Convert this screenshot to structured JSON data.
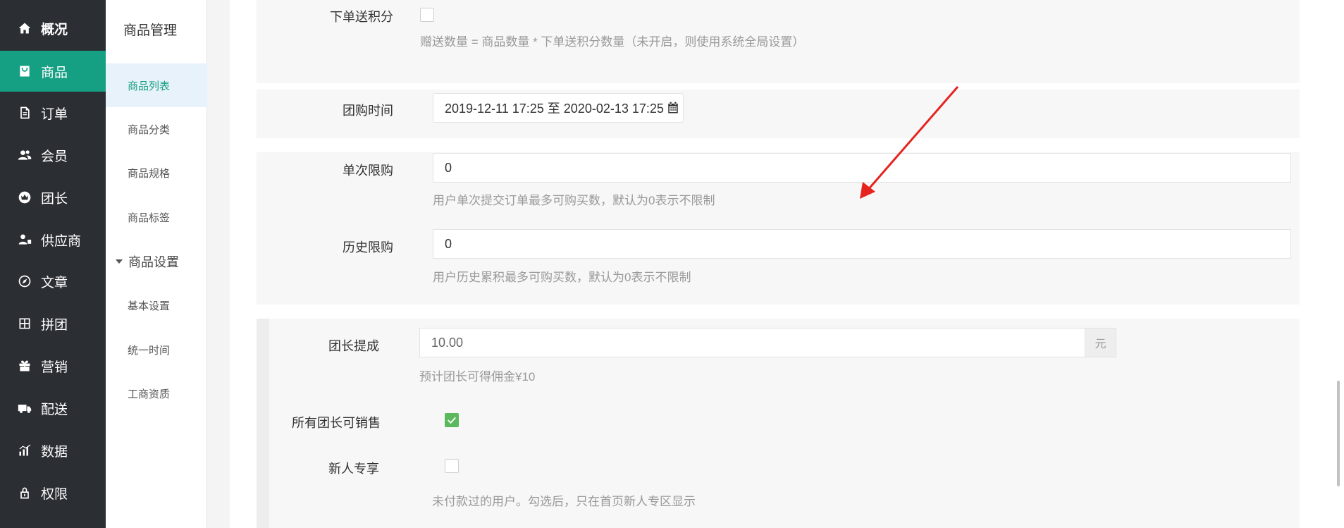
{
  "nav": {
    "items": [
      {
        "label": "概况",
        "icon": "home-icon"
      },
      {
        "label": "商品",
        "icon": "bag-icon"
      },
      {
        "label": "订单",
        "icon": "document-icon"
      },
      {
        "label": "会员",
        "icon": "users-icon"
      },
      {
        "label": "团长",
        "icon": "crown-icon"
      },
      {
        "label": "供应商",
        "icon": "supplier-icon"
      },
      {
        "label": "文章",
        "icon": "compass-icon"
      },
      {
        "label": "拼团",
        "icon": "grid-icon"
      },
      {
        "label": "营销",
        "icon": "gift-icon"
      },
      {
        "label": "配送",
        "icon": "truck-icon"
      },
      {
        "label": "数据",
        "icon": "bar-chart-icon"
      },
      {
        "label": "权限",
        "icon": "lock-icon"
      }
    ],
    "active_color": "#15a083",
    "bg_color": "#2b2e33"
  },
  "subnav": {
    "title": "商品管理",
    "items": [
      "商品列表",
      "商品分类",
      "商品规格",
      "商品标签"
    ],
    "group": "商品设置",
    "group_items": [
      "基本设置",
      "统一时间",
      "工商资质"
    ]
  },
  "form": {
    "order_points_label": "下单送积分",
    "order_points_help": "赠送数量 = 商品数量 * 下单送积分数量（未开启，则使用系统全局设置）",
    "group_time_label": "团购时间",
    "group_time_value": "2019-12-11 17:25 至 2020-02-13 17:25",
    "single_limit_label": "单次限购",
    "single_limit_value": "0",
    "single_limit_help": "用户单次提交订单最多可购买数，默认为0表示不限制",
    "history_limit_label": "历史限购",
    "history_limit_value": "0",
    "history_limit_help": "用户历史累积最多可购买数，默认为0表示不限制",
    "commission_label": "团长提成",
    "commission_value": "10.00",
    "commission_unit": "元",
    "commission_help": "预计团长可得佣金¥10",
    "all_leaders_label": "所有团长可销售",
    "all_leaders_checked": true,
    "newcomer_label": "新人专享",
    "newcomer_checked": false,
    "newcomer_help": "未付款过的用户。勾选后，只在首页新人专区显示"
  }
}
